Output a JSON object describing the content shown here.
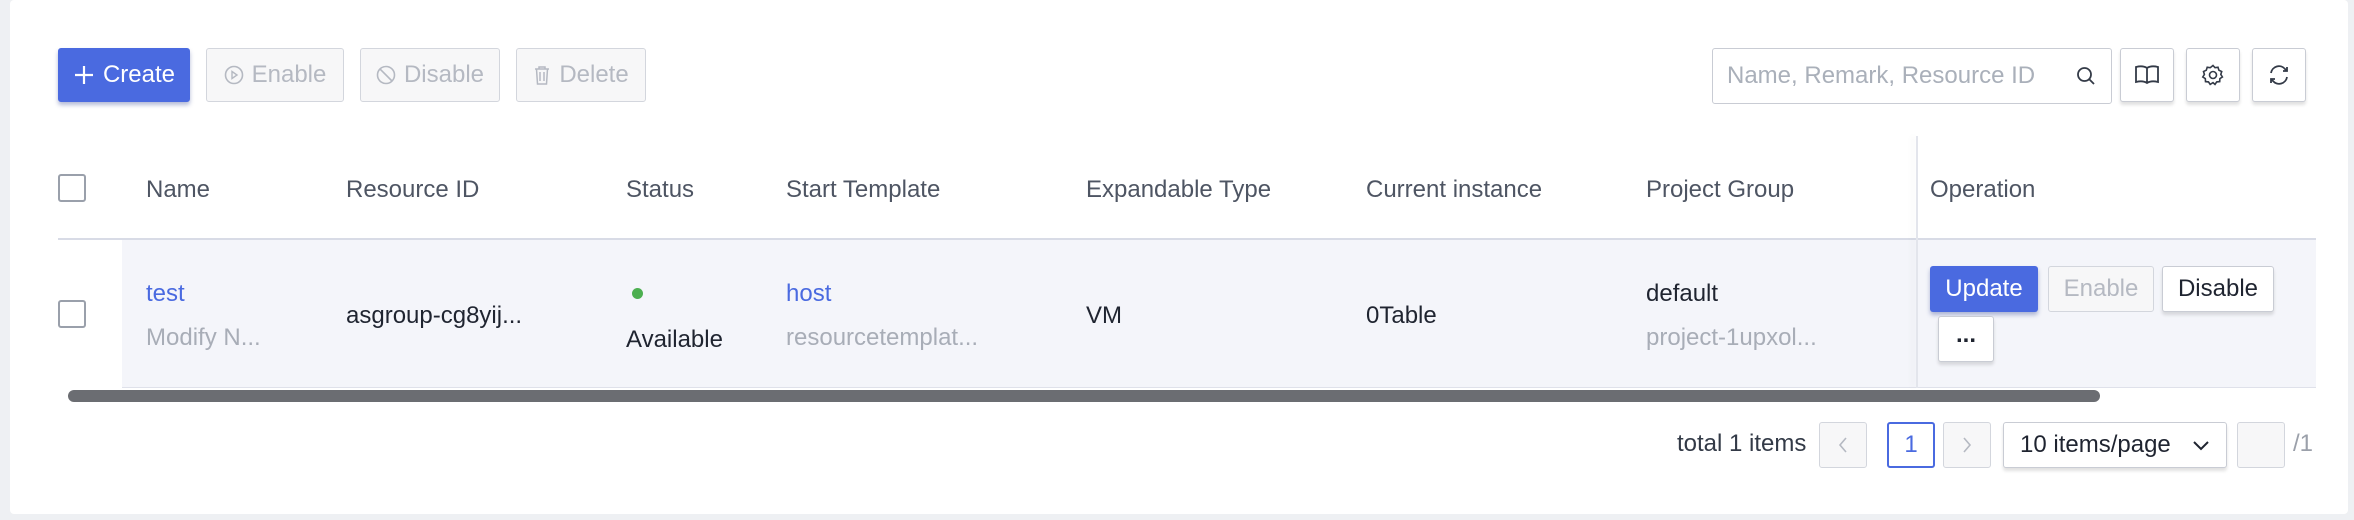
{
  "toolbar": {
    "create_label": "Create",
    "enable_label": "Enable",
    "disable_label": "Disable",
    "delete_label": "Delete",
    "search_placeholder": "Name, Remark, Resource ID"
  },
  "table": {
    "columns": [
      "Name",
      "Resource ID",
      "Status",
      "Start Template",
      "Expandable Type",
      "Current instance",
      "Project Group",
      "Operation"
    ],
    "rows": [
      {
        "name": "test",
        "remark": "Modify N...",
        "resource_id": "asgroup-cg8yij...",
        "status": "Available",
        "template_name": "host",
        "template_id": "resourcetemplat...",
        "expandable_type": "VM",
        "current_instance": "0Table",
        "project_group": "default",
        "project_id": "project-1upxol...",
        "ops": {
          "update": "Update",
          "enable": "Enable",
          "disable": "Disable",
          "more": "..."
        }
      }
    ]
  },
  "pagination": {
    "total_text": "total 1 items",
    "current_page": "1",
    "page_size": "10 items/page",
    "total_pages": "/1"
  },
  "colors": {
    "primary": "#4a6ae0",
    "status_available": "#4caf50"
  }
}
